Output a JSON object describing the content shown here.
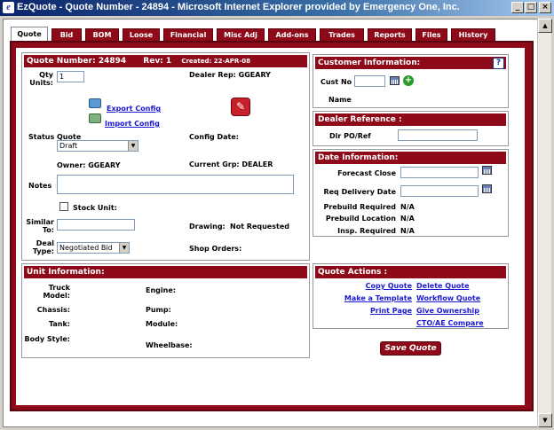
{
  "window": {
    "title": "EzQuote - Quote Number - 24894 - Microsoft Internet Explorer provided by Emergency One, Inc.",
    "app_icon": "e-icon",
    "min": "_",
    "max": "□",
    "close": "×"
  },
  "tabs": [
    "Quote",
    "Bid",
    "BOM",
    "Loose",
    "Financial",
    "Misc Adj",
    "Add-ons",
    "Trades",
    "Reports",
    "Files",
    "History"
  ],
  "quote": {
    "number_label": "Quote Number: 24894",
    "rev": "Rev: 1",
    "created": "Created: 22-APR-08",
    "qty_label": "Qty Units:",
    "qty_value": "1",
    "dealer_rep": "Dealer Rep: GGEARY",
    "export": "Export Config",
    "import": "Import Config",
    "status_label": "Status",
    "status_title": "Quote",
    "status_value": "Draft",
    "config_date": "Config Date:",
    "owner": "Owner: GGEARY",
    "current_grp": "Current Grp: DEALER",
    "notes_label": "Notes",
    "stock_unit": "Stock Unit:",
    "similar_label": "Similar To:",
    "drawing_label": "Drawing:",
    "drawing_value": "Not Requested",
    "deal_type_label": "Deal Type:",
    "deal_type_value": "Negotiated Bid",
    "shop_orders": "Shop Orders:"
  },
  "customer": {
    "title": "Customer Information:",
    "cust_no": "Cust No",
    "name": "Name"
  },
  "dealer_ref": {
    "title": "Dealer Reference :",
    "dlr_po": "Dlr PO/Ref"
  },
  "date_info": {
    "title": "Date Information:",
    "forecast": "Forecast Close",
    "req_delivery": "Req Delivery Date",
    "prebuild_required": "Prebuild Required",
    "prebuild_required_val": "N/A",
    "prebuild_location": "Prebuild Location",
    "prebuild_location_val": "N/A",
    "insp_required": "Insp. Required",
    "insp_required_val": "N/A"
  },
  "unit": {
    "title": "Unit Information:",
    "truck_model": "Truck Model:",
    "engine": "Engine:",
    "chassis": "Chassis:",
    "pump": "Pump:",
    "tank": "Tank:",
    "module": "Module:",
    "body_style": "Body Style:",
    "wheelbase": "Wheelbase:"
  },
  "actions": {
    "title": "Quote Actions :",
    "copy": "Copy Quote",
    "delete": "Delete Quote",
    "template": "Make a Template",
    "workflow": "Workflow Quote",
    "print": "Print Page",
    "ownership": "Give Ownership",
    "cto": "CTO/AE Compare",
    "save": "Save Quote"
  },
  "colors": {
    "accent": "#8e0a19",
    "link": "#1a1ad0"
  }
}
